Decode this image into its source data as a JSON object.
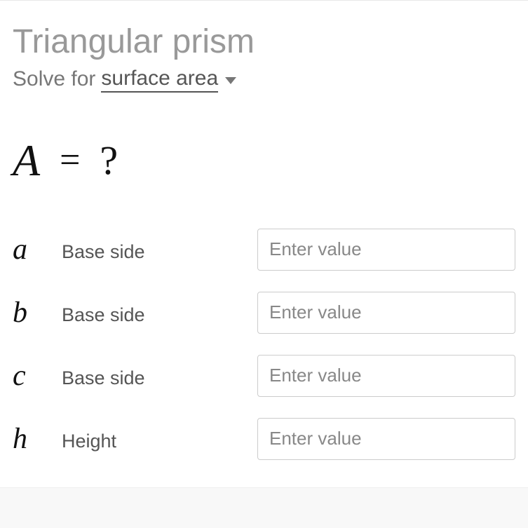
{
  "title": "Triangular prism",
  "solve_for_label": "Solve for",
  "selector_value": "surface area",
  "formula": {
    "lhs": "A",
    "eq": "=",
    "rhs": "?"
  },
  "params": [
    {
      "symbol": "a",
      "label": "Base side",
      "placeholder": "Enter value"
    },
    {
      "symbol": "b",
      "label": "Base side",
      "placeholder": "Enter value"
    },
    {
      "symbol": "c",
      "label": "Base side",
      "placeholder": "Enter value"
    },
    {
      "symbol": "h",
      "label": "Height",
      "placeholder": "Enter value"
    }
  ]
}
